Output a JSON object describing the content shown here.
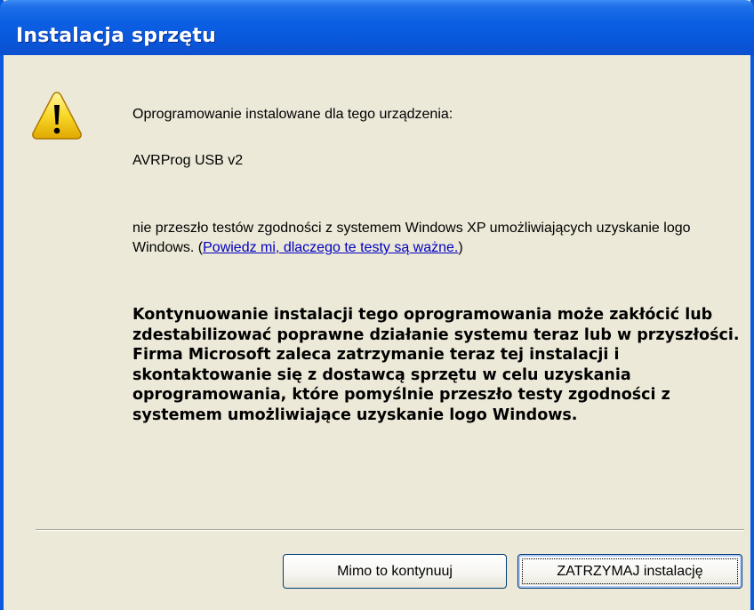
{
  "window": {
    "title": "Instalacja sprzętu"
  },
  "dialog": {
    "icon": "warning-icon",
    "intro": "Oprogramowanie instalowane dla tego urządzenia:",
    "device_name": "AVRProg USB v2",
    "compat_text": "nie przeszło testów zgodności z systemem Windows XP umożliwiających uzyskanie logo Windows. (",
    "compat_link": "Powiedz mi, dlaczego te testy są ważne.",
    "compat_close": ")",
    "warning_text": "Kontynuowanie instalacji tego oprogramowania może zakłócić lub zdestabilizować poprawne działanie systemu teraz lub w przyszłości. Firma Microsoft zaleca zatrzymanie teraz tej instalacji i skontaktowanie się z dostawcą sprzętu w celu uzyskania oprogramowania, które pomyślnie przeszło testy zgodności z systemem umożliwiające uzyskanie logo Windows."
  },
  "buttons": {
    "continue_label": "Mimo to kontynuuj",
    "stop_label": "ZATRZYMAJ instalację"
  },
  "colors": {
    "titlebar": "#0a58dc",
    "dialog_bg": "#ece9d8",
    "link": "#0000c0"
  }
}
